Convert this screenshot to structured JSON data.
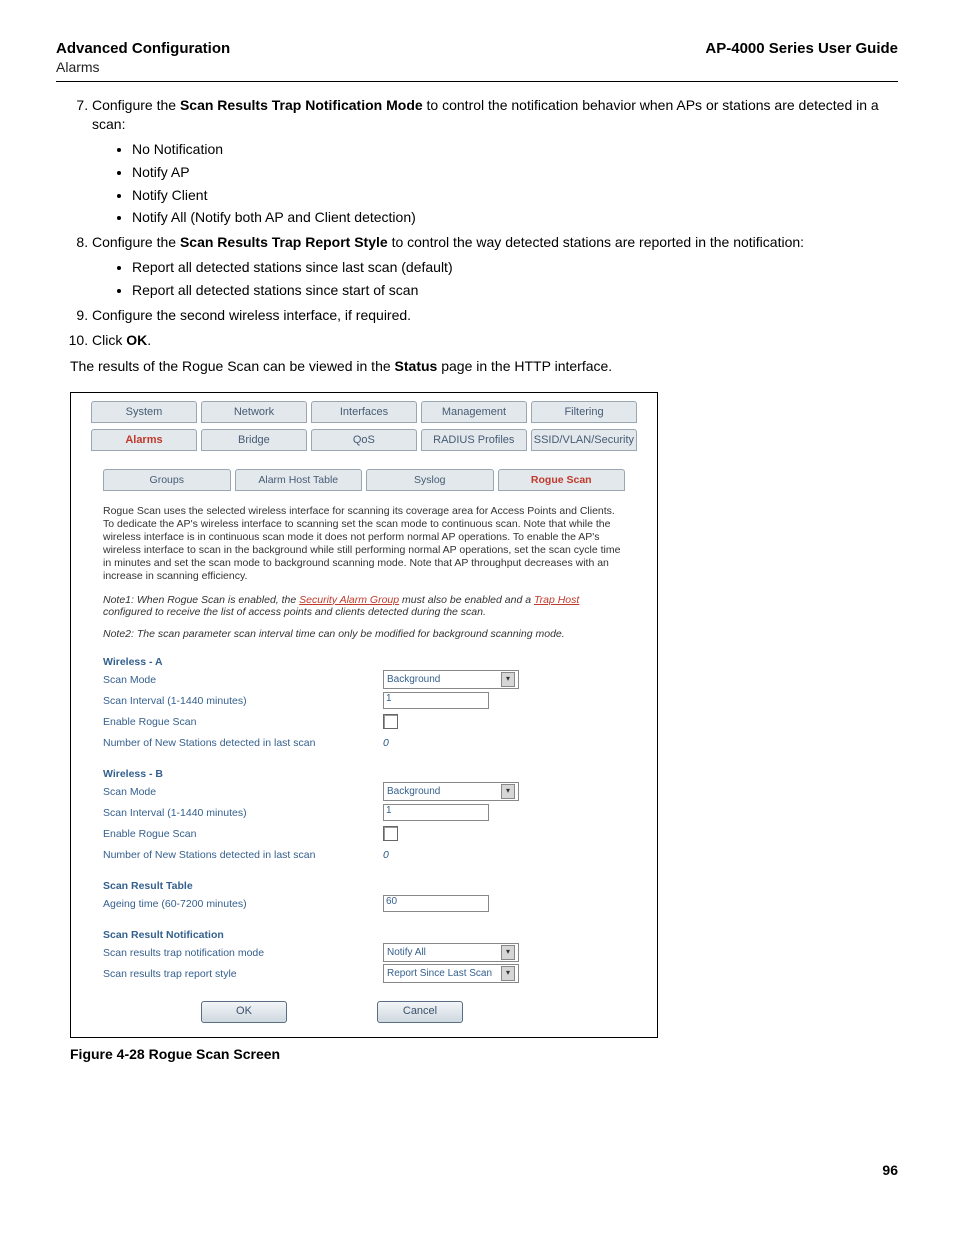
{
  "header": {
    "left": "Advanced Configuration",
    "right": "AP-4000 Series User Guide",
    "sub": "Alarms"
  },
  "step7": {
    "pre": "Configure the ",
    "bold": "Scan Results Trap Notification Mode",
    "post": " to control the notification behavior when APs or stations are detected in a scan:",
    "items": [
      "No Notification",
      "Notify AP",
      "Notify Client",
      "Notify All (Notify both AP and Client detection)"
    ]
  },
  "step8": {
    "pre": "Configure the ",
    "bold": "Scan Results Trap Report Style",
    "post": " to control the way detected stations are reported in the notification:",
    "items": [
      "Report all detected stations since last scan (default)",
      "Report all detected stations since start of scan"
    ]
  },
  "step9": "Configure the second wireless interface, if required.",
  "step10": {
    "pre": "Click ",
    "bold": "OK",
    "post": "."
  },
  "results_para": {
    "pre": "The results of the Rogue Scan can be viewed in the ",
    "bold": "Status",
    "post": " page in the HTTP interface."
  },
  "shot": {
    "tabs_top": [
      "System",
      "Network",
      "Interfaces",
      "Management",
      "Filtering"
    ],
    "tabs_sub": [
      "Alarms",
      "Bridge",
      "QoS",
      "RADIUS Profiles",
      "SSID/VLAN/Security"
    ],
    "tabs_inner": [
      "Groups",
      "Alarm Host Table",
      "Syslog",
      "Rogue Scan"
    ],
    "desc": "Rogue Scan uses the selected wireless interface for scanning its coverage area for Access Points and Clients. To dedicate the AP's wireless interface to scanning set the scan mode to continuous scan. Note that while the wireless interface is in continuous scan mode it does not perform normal AP operations. To enable the AP's wireless interface to scan in the background while still performing normal AP operations, set the scan cycle time in minutes and set the scan mode to background scanning mode. Note that AP throughput decreases with an increase in scanning efficiency.",
    "note1_a": "Note1: When Rogue Scan is enabled, the ",
    "note1_red1": "Security Alarm Group",
    "note1_b": " must also be enabled and a ",
    "note1_red2": "Trap Host",
    "note1_c": " configured to receive the list of access points and clients detected during the scan.",
    "note2": "Note2: The scan parameter scan interval time can only be modified for background scanning mode.",
    "wa": {
      "title": "Wireless - A",
      "scan_mode_lbl": "Scan Mode",
      "scan_mode_val": "Background",
      "interval_lbl": "Scan Interval (1-1440 minutes)",
      "interval_val": "1",
      "enable_lbl": "Enable Rogue Scan",
      "new_lbl": "Number of New Stations detected in last scan",
      "new_val": "0"
    },
    "wb": {
      "title": "Wireless - B",
      "scan_mode_lbl": "Scan Mode",
      "scan_mode_val": "Background",
      "interval_lbl": "Scan Interval (1-1440 minutes)",
      "interval_val": "1",
      "enable_lbl": "Enable Rogue Scan",
      "new_lbl": "Number of New Stations detected in last scan",
      "new_val": "0"
    },
    "srt": {
      "title": "Scan Result Table",
      "age_lbl": "Ageing time (60-7200 minutes)",
      "age_val": "60"
    },
    "srn": {
      "title": "Scan Result Notification",
      "mode_lbl": "Scan results trap notification mode",
      "mode_val": "Notify All",
      "style_lbl": "Scan results trap report style",
      "style_val": "Report Since Last Scan"
    },
    "ok": "OK",
    "cancel": "Cancel"
  },
  "figure_caption": "Figure 4-28 Rogue Scan Screen",
  "page_number": "96"
}
